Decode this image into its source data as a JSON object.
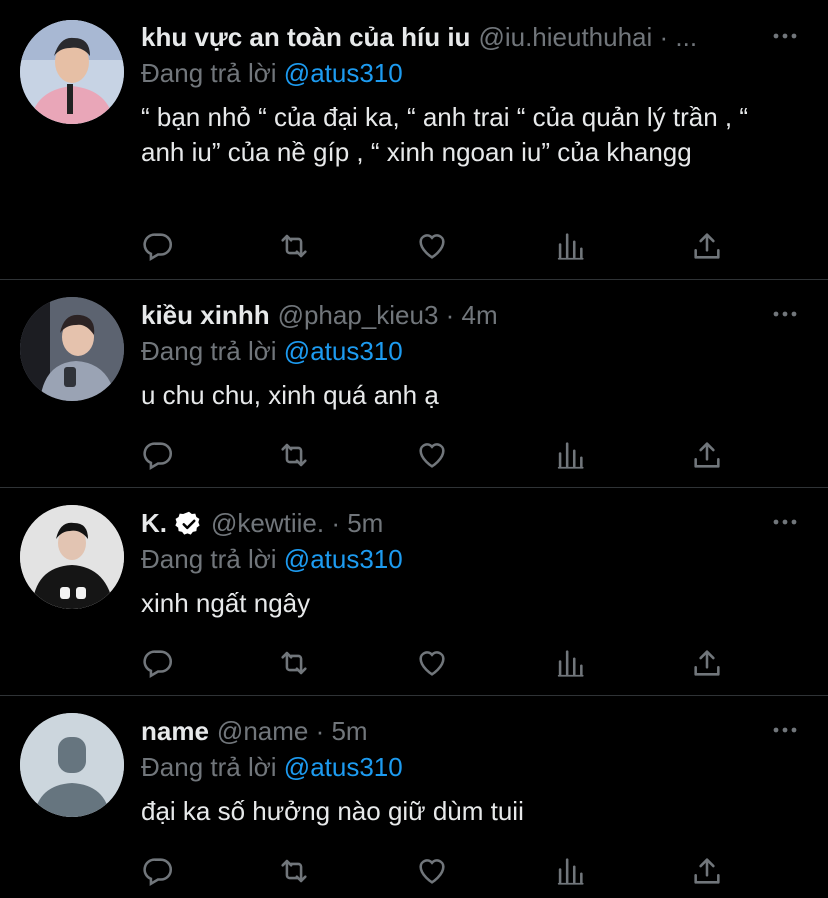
{
  "reply_prefix": "Đang trả lời",
  "tweets": [
    {
      "name": "khu vực an toàn của híu iu",
      "meta": "@iu.hieuthuhai · ...",
      "reply_to": "@atus310",
      "text": "“ bạn nhỏ “ của đại ka, “ anh trai “ của quản lý trần , “ anh iu” của nề gíp , “ xinh ngoan iu” của khangg"
    },
    {
      "name": "kiều xinhh",
      "meta": "@phap_kieu3 · 4m",
      "reply_to": "@atus310",
      "text": "u chu chu, xinh quá anh ạ"
    },
    {
      "name": "K.",
      "verified": true,
      "meta": "@kewtiie. · 5m",
      "reply_to": "@atus310",
      "text": "xinh ngất ngây"
    },
    {
      "name": "name",
      "meta": "@name · 5m",
      "reply_to": "@atus310",
      "text": "đại ka số hưởng nào giữ dùm tuii"
    }
  ],
  "colors": {
    "background": "#000000",
    "text": "#e7e9ea",
    "muted": "#71767b",
    "link": "#1d9bf0",
    "verified": "#ffffff"
  },
  "icons": [
    "reply-icon",
    "retweet-icon",
    "like-icon",
    "views-icon",
    "share-icon",
    "more-icon",
    "verified-badge-icon"
  ]
}
